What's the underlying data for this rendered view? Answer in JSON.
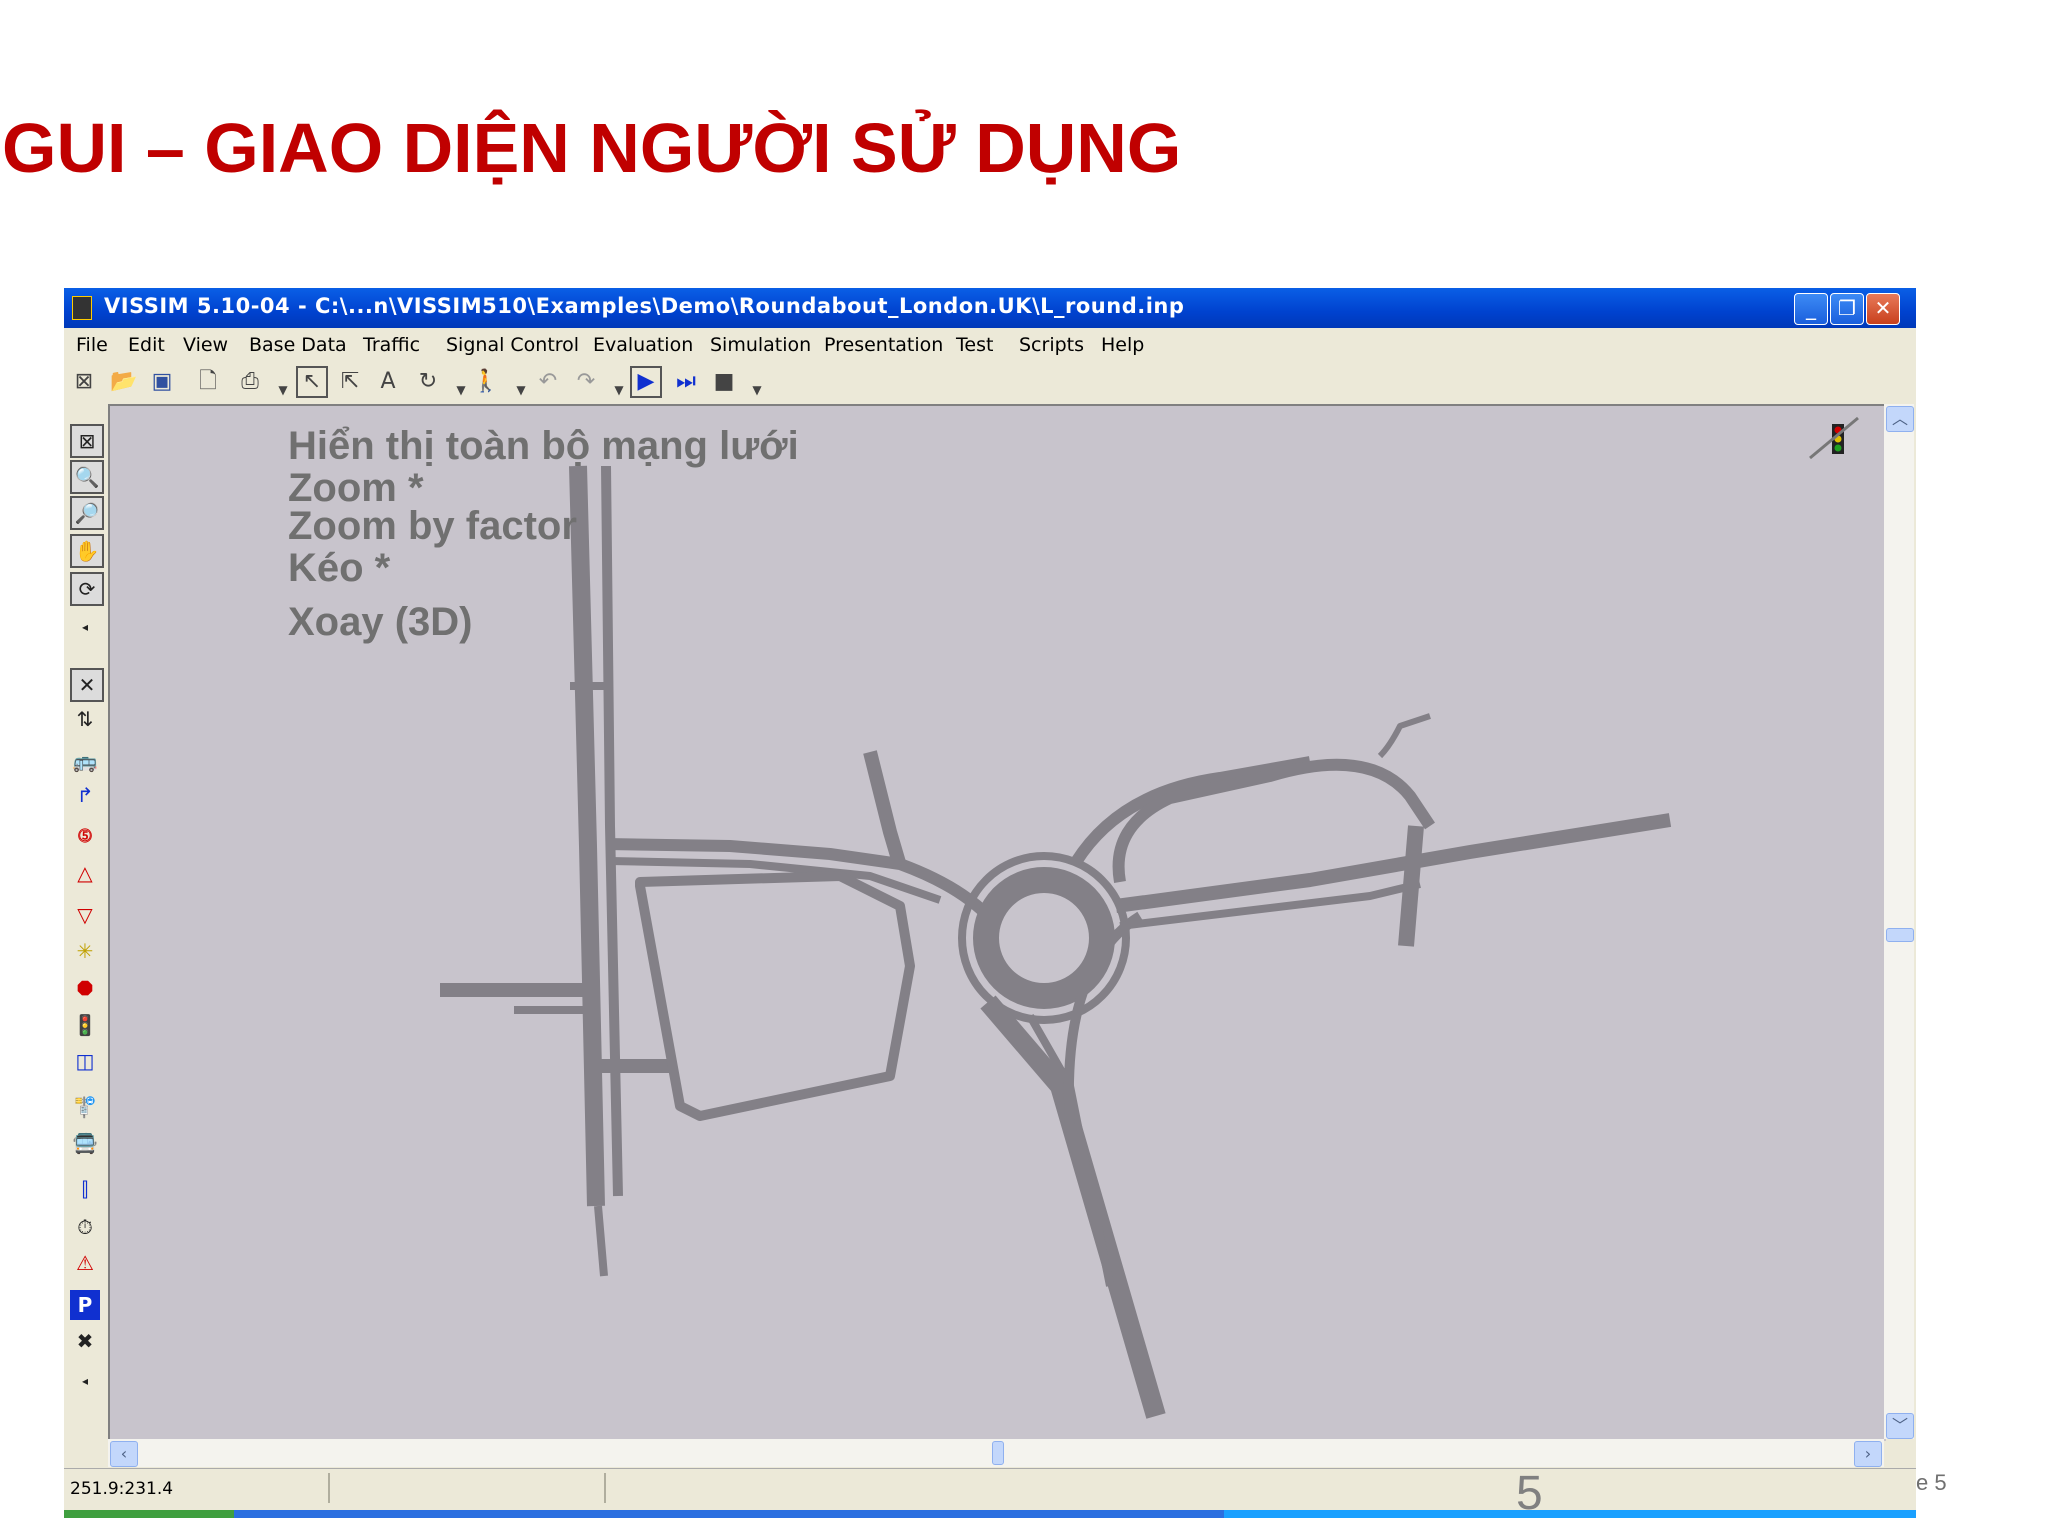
{
  "slide": {
    "title": "GUI – GIAO DIỆN NGƯỜI SỬ DỤNG",
    "slide_number": "5",
    "page_fragment": "e 5"
  },
  "window": {
    "title": "VISSIM 5.10-04 - C:\\...n\\VISSIM510\\Examples\\Demo\\Roundabout_London.UK\\L_round.inp",
    "controls": {
      "minimize": "_",
      "restore": "❐",
      "close": "✕"
    }
  },
  "menu": [
    "File",
    "Edit",
    "View",
    "Base Data",
    "Traffic",
    "Signal Control",
    "Evaluation",
    "Simulation",
    "Presentation",
    "Test",
    "Scripts",
    "Help"
  ],
  "toolbar": {
    "icons": [
      "new-network-icon",
      "open-folder-icon",
      "save-disk-icon",
      "print-preview-icon",
      "printer-icon",
      "select-pointer-icon",
      "multi-select-icon",
      "text-label-icon",
      "rotate-icon",
      "pedestrian-icon",
      "undo-icon",
      "redo-icon",
      "play-continuous-icon",
      "single-step-icon",
      "stop-icon"
    ]
  },
  "left_toolbar": {
    "icons": [
      "show-entire-network-icon",
      "zoom-icon",
      "zoom-by-factor-icon",
      "pan-hand-icon",
      "rotate-3d-icon",
      "links-icon",
      "vehicle-inputs-icon",
      "routing-icon",
      "speed-limit-icon",
      "reduced-speed-icon",
      "priority-rules-icon",
      "conflict-areas-icon",
      "stop-sign-icon",
      "signal-head-icon",
      "detectors-icon",
      "transit-stops-icon",
      "transit-lines-icon",
      "nodes-icon",
      "travel-time-icon",
      "queue-counter-icon",
      "parking-icon",
      "network-closed-icon"
    ]
  },
  "annotations": {
    "show_network": "Hiển thị toàn bộ mạng lưới",
    "zoom": "Zoom  *",
    "zoom_factor": "Zoom by factor",
    "pan": "Kéo *",
    "rotate": "Xoay (3D)"
  },
  "status": {
    "coords": "251.9:231.4"
  },
  "colors": {
    "title_red": "#c00000",
    "titlebar_blue": "#0a5fe6",
    "canvas_bg": "#c8c4cc",
    "road_gray": "#838087"
  }
}
